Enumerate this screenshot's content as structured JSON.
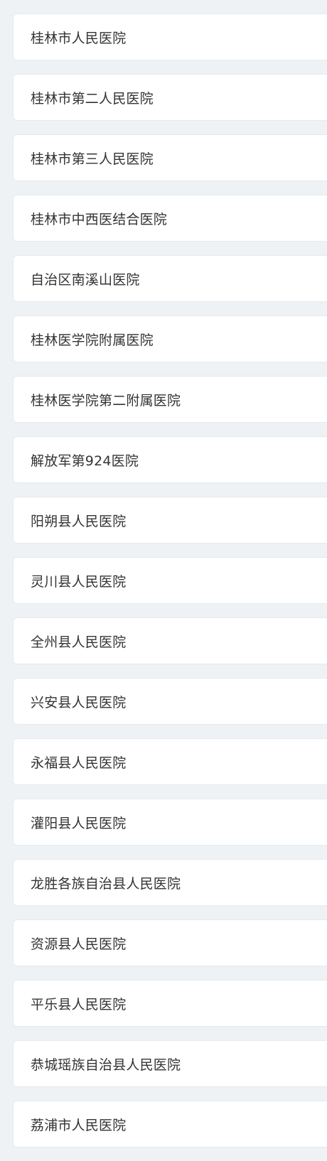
{
  "hospitals": [
    {
      "name": "桂林市人民医院"
    },
    {
      "name": "桂林市第二人民医院"
    },
    {
      "name": "桂林市第三人民医院"
    },
    {
      "name": "桂林市中西医结合医院"
    },
    {
      "name": "自治区南溪山医院"
    },
    {
      "name": "桂林医学院附属医院"
    },
    {
      "name": "桂林医学院第二附属医院"
    },
    {
      "name": "解放军第924医院"
    },
    {
      "name": "阳朔县人民医院"
    },
    {
      "name": "灵川县人民医院"
    },
    {
      "name": "全州县人民医院"
    },
    {
      "name": "兴安县人民医院"
    },
    {
      "name": "永福县人民医院"
    },
    {
      "name": "灌阳县人民医院"
    },
    {
      "name": "龙胜各族自治县人民医院"
    },
    {
      "name": "资源县人民医院"
    },
    {
      "name": "平乐县人民医院"
    },
    {
      "name": "恭城瑶族自治县人民医院"
    },
    {
      "name": "荔浦市人民医院"
    }
  ]
}
